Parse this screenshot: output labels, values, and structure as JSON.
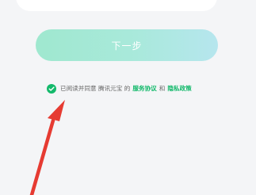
{
  "next_button": {
    "label": "下一步"
  },
  "agreement": {
    "prefix": "已阅读并同意 腾讯元宝 的",
    "terms_link": "服务协议",
    "and": "和",
    "privacy_link": "隐私政策",
    "checked": true
  },
  "colors": {
    "accent_green": "#13b96b",
    "button_gradient_start": "#9fe8cf",
    "button_gradient_end": "#b6e6ee",
    "arrow_red": "#e63b32"
  },
  "icons": {
    "checkbox": "check-circle-icon",
    "annotation": "red-arrow-icon"
  }
}
